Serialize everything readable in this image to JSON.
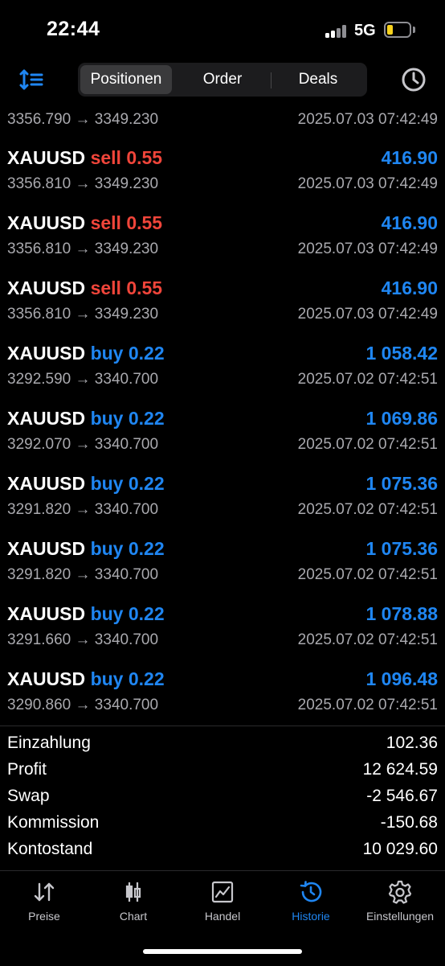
{
  "status_bar": {
    "time": "22:44",
    "network": "5G",
    "battery_level": 0.25,
    "battery_color": "#f7d21d"
  },
  "toolbar": {
    "sort_icon": "sort-list-icon",
    "tabs": [
      {
        "label": "Positionen",
        "active": true
      },
      {
        "label": "Order",
        "active": false
      },
      {
        "label": "Deals",
        "active": false
      }
    ],
    "history_icon": "clock-icon"
  },
  "top_partial_row": {
    "prices": "3356.790 → 3349.230",
    "datetime": "2025.07.03 07:42:49"
  },
  "trades": [
    {
      "symbol": "XAUUSD",
      "side": "sell 0.55",
      "profit": "416.90",
      "prices": "3356.810 → 3349.230",
      "datetime": "2025.07.03 07:42:49"
    },
    {
      "symbol": "XAUUSD",
      "side": "sell 0.55",
      "profit": "416.90",
      "prices": "3356.810 → 3349.230",
      "datetime": "2025.07.03 07:42:49"
    },
    {
      "symbol": "XAUUSD",
      "side": "sell 0.55",
      "profit": "416.90",
      "prices": "3356.810 → 3349.230",
      "datetime": "2025.07.03 07:42:49"
    },
    {
      "symbol": "XAUUSD",
      "side": "buy 0.22",
      "profit": "1 058.42",
      "prices": "3292.590 → 3340.700",
      "datetime": "2025.07.02 07:42:51"
    },
    {
      "symbol": "XAUUSD",
      "side": "buy 0.22",
      "profit": "1 069.86",
      "prices": "3292.070 → 3340.700",
      "datetime": "2025.07.02 07:42:51"
    },
    {
      "symbol": "XAUUSD",
      "side": "buy 0.22",
      "profit": "1 075.36",
      "prices": "3291.820 → 3340.700",
      "datetime": "2025.07.02 07:42:51"
    },
    {
      "symbol": "XAUUSD",
      "side": "buy 0.22",
      "profit": "1 075.36",
      "prices": "3291.820 → 3340.700",
      "datetime": "2025.07.02 07:42:51"
    },
    {
      "symbol": "XAUUSD",
      "side": "buy 0.22",
      "profit": "1 078.88",
      "prices": "3291.660 → 3340.700",
      "datetime": "2025.07.02 07:42:51"
    },
    {
      "symbol": "XAUUSD",
      "side": "buy 0.22",
      "profit": "1 096.48",
      "prices": "3290.860 → 3340.700",
      "datetime": "2025.07.02 07:42:51"
    }
  ],
  "summary": [
    {
      "label": "Einzahlung",
      "value": "102.36"
    },
    {
      "label": "Profit",
      "value": "12 624.59"
    },
    {
      "label": "Swap",
      "value": "-2 546.67"
    },
    {
      "label": "Kommission",
      "value": "-150.68"
    },
    {
      "label": "Kontostand",
      "value": "10 029.60"
    }
  ],
  "tabbar": [
    {
      "label": "Preise",
      "icon": "arrows-updown-icon",
      "active": false
    },
    {
      "label": "Chart",
      "icon": "candlestick-icon",
      "active": false
    },
    {
      "label": "Handel",
      "icon": "trade-chart-icon",
      "active": false
    },
    {
      "label": "Historie",
      "icon": "history-icon",
      "active": true
    },
    {
      "label": "Einstellungen",
      "icon": "gear-icon",
      "active": false
    }
  ],
  "colors": {
    "sell": "#f0453a",
    "buy": "#1f86f2",
    "profit": "#1f86f2",
    "secondary_text": "#a9a9ae",
    "active_tab": "#1f86f2"
  }
}
